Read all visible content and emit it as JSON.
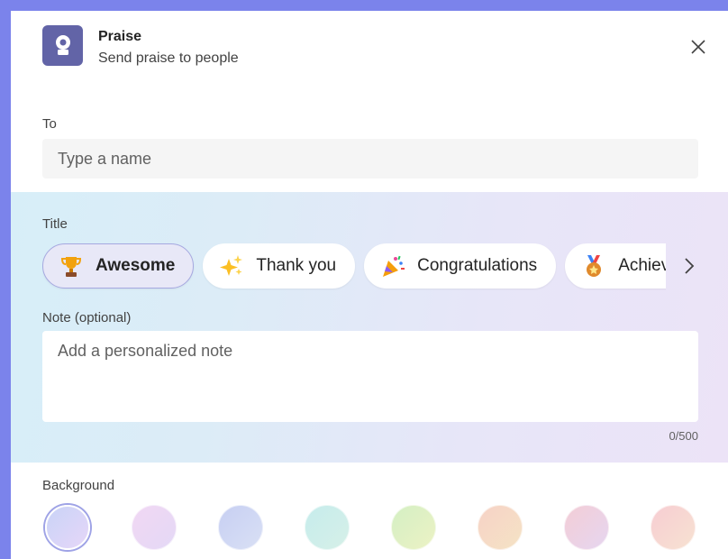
{
  "header": {
    "title": "Praise",
    "subtitle": "Send praise to people",
    "app_icon": "praise-badge-icon",
    "close_icon": "close-icon"
  },
  "to": {
    "label": "To",
    "placeholder": "Type a name"
  },
  "title_section": {
    "label": "Title",
    "chips": [
      {
        "label": "Awesome",
        "icon": "trophy-icon",
        "selected": true
      },
      {
        "label": "Thank you",
        "icon": "sparkles-icon",
        "selected": false
      },
      {
        "label": "Congratulations",
        "icon": "party-popper-icon",
        "selected": false
      },
      {
        "label": "Achiever",
        "icon": "medal-icon",
        "selected": false
      }
    ],
    "next_icon": "chevron-right-icon"
  },
  "note": {
    "label": "Note (optional)",
    "placeholder": "Add a personalized note",
    "counter": "0/500"
  },
  "background": {
    "label": "Background",
    "swatches": [
      {
        "colors": [
          "#c9d4f7",
          "#e6d6f8"
        ],
        "selected": true
      },
      {
        "colors": [
          "#f1d7f3",
          "#e4d9f6"
        ],
        "selected": false
      },
      {
        "colors": [
          "#c7cff2",
          "#d9e0f5"
        ],
        "selected": false
      },
      {
        "colors": [
          "#c6ecec",
          "#d6f0e8"
        ],
        "selected": false
      },
      {
        "colors": [
          "#d4efc3",
          "#ecf2c5"
        ],
        "selected": false
      },
      {
        "colors": [
          "#f6d2c6",
          "#f5e3c5"
        ],
        "selected": false
      },
      {
        "colors": [
          "#f3cdd6",
          "#e6d6f0"
        ],
        "selected": false
      },
      {
        "colors": [
          "#f7cdd3",
          "#f7e2d1"
        ],
        "selected": false
      }
    ]
  },
  "colors": {
    "accent": "#6264a7",
    "frame": "#7b83eb"
  }
}
